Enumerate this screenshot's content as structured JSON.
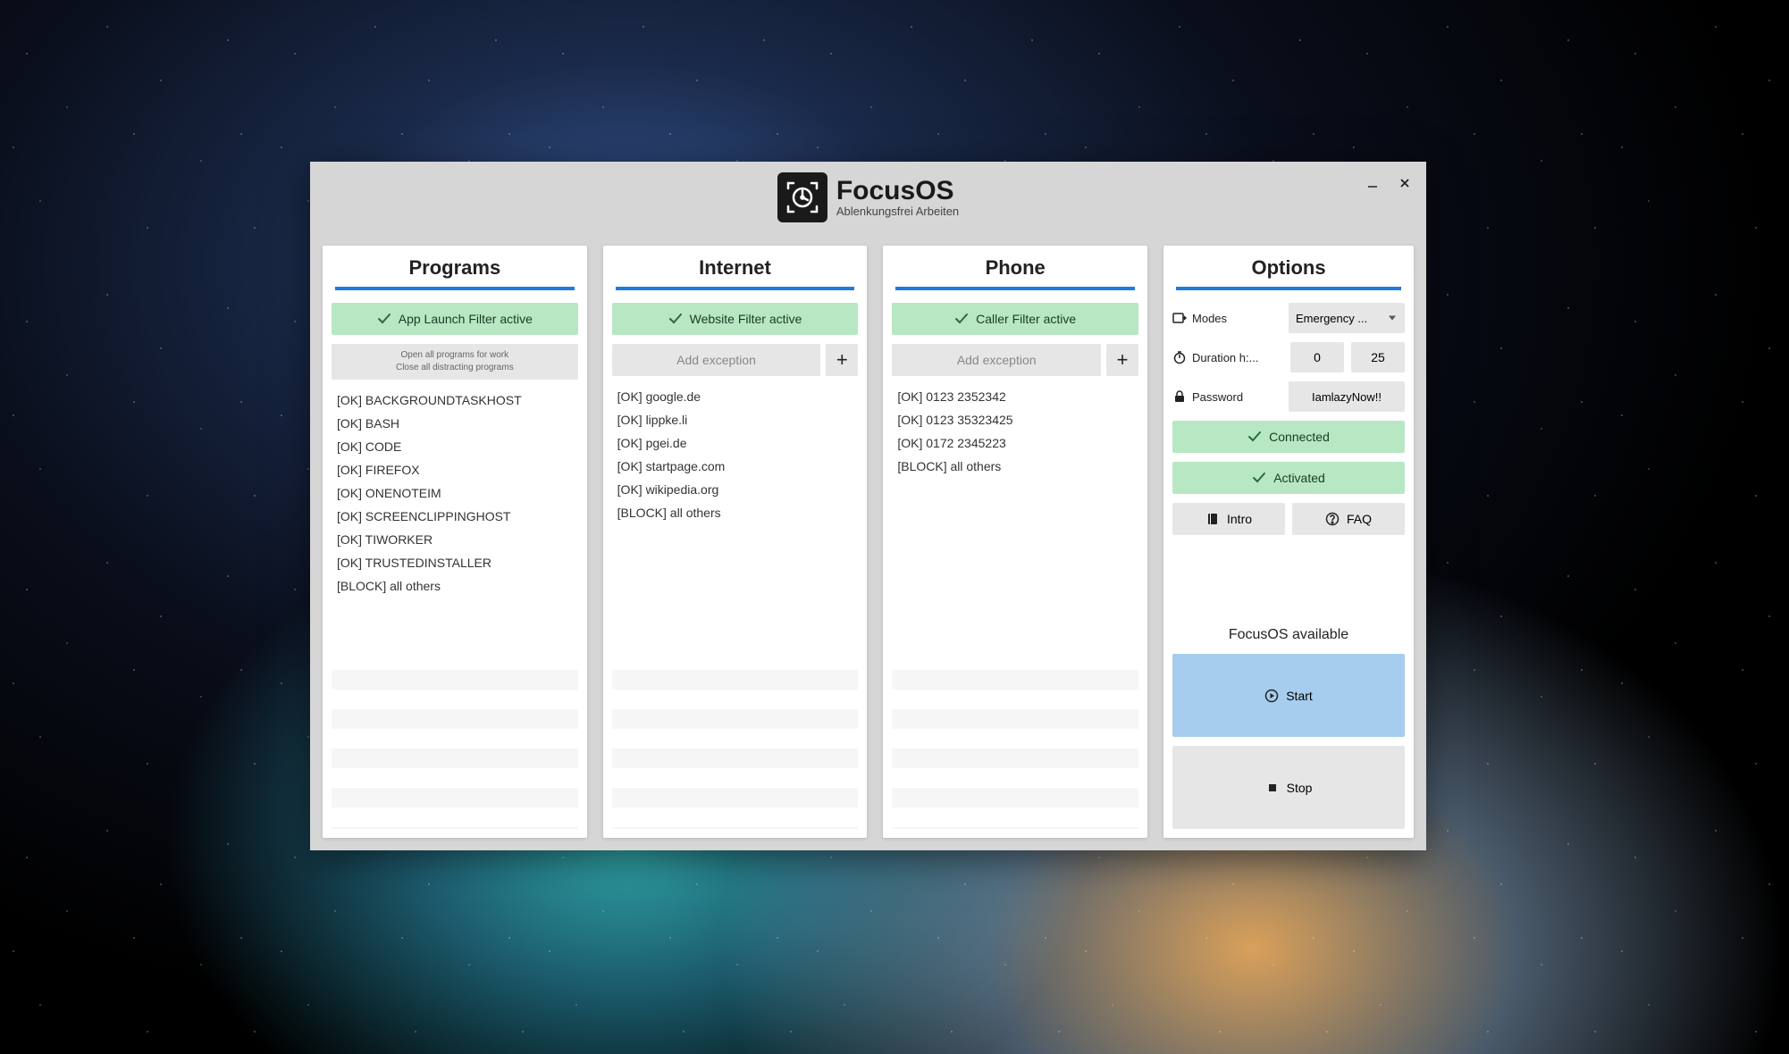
{
  "app": {
    "title": "FocusOS",
    "subtitle": "Ablenkungsfrei Arbeiten"
  },
  "panels": {
    "programs": {
      "title": "Programs",
      "status": "App Launch Filter active",
      "subtext1": "Open all programs for work",
      "subtext2": "Close all distracting programs",
      "items": [
        "[OK] BACKGROUNDTASKHOST",
        "[OK] BASH",
        "[OK] CODE",
        "[OK] FIREFOX",
        "[OK] ONENOTEIM",
        "[OK] SCREENCLIPPINGHOST",
        "[OK] TIWORKER",
        "[OK] TRUSTEDINSTALLER",
        "[BLOCK] all others"
      ]
    },
    "internet": {
      "title": "Internet",
      "status": "Website Filter active",
      "add_placeholder": "Add exception",
      "items": [
        "[OK] google.de",
        "[OK] lippke.li",
        "[OK] pgei.de",
        "[OK] startpage.com",
        "[OK] wikipedia.org",
        "[BLOCK] all others"
      ]
    },
    "phone": {
      "title": "Phone",
      "status": "Caller Filter active",
      "add_placeholder": "Add exception",
      "items": [
        "[OK] 0123 2352342",
        "[OK] 0123 35323425",
        "[OK] 0172 2345223",
        "[BLOCK] all others"
      ]
    },
    "options": {
      "title": "Options",
      "modes_label": "Modes",
      "modes_value": "Emergency ...",
      "duration_label": "Duration h:...",
      "hours": "0",
      "minutes": "25",
      "password_label": "Password",
      "password_value": "IamlazyNow!!",
      "connected": "Connected",
      "activated": "Activated",
      "intro": "Intro",
      "faq": "FAQ",
      "available": "FocusOS available",
      "start": "Start",
      "stop": "Stop"
    }
  }
}
